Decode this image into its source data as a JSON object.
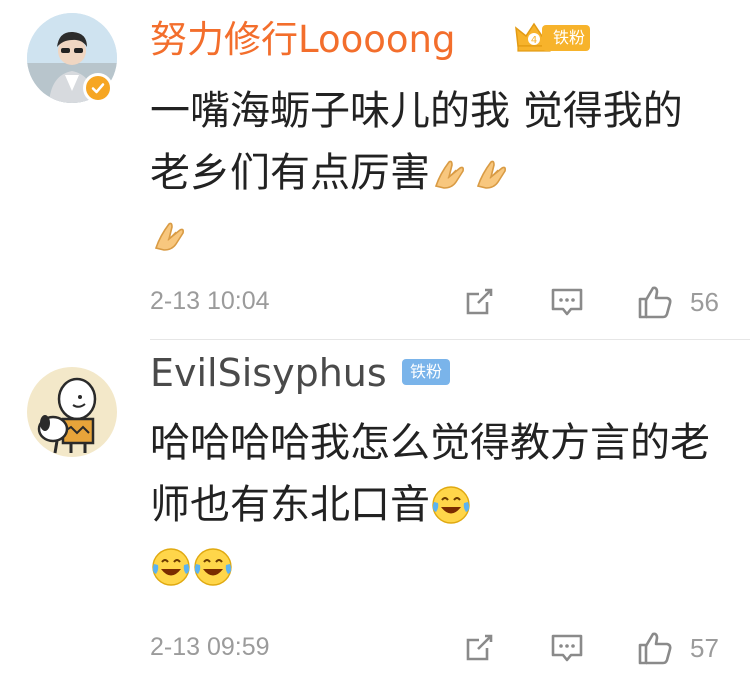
{
  "comments": [
    {
      "username": "努力修行Loooong",
      "badge": "铁粉",
      "badge_level": "4",
      "text": "一嘴海蛎子味儿的我 觉得我的老乡们有点厉害",
      "emojis": [
        "pray",
        "pray",
        "pray"
      ],
      "time": "2-13 10:04",
      "likes": "56",
      "name_color": "#f36e2c",
      "badge_color": "#f7b32b"
    },
    {
      "username": "EvilSisyphus",
      "badge": "铁粉",
      "text": "哈哈哈哈我怎么觉得教方言的老师也有东北口音",
      "emojis": [
        "laugh-cry",
        "laugh-cry",
        "laugh-cry"
      ],
      "time": "2-13 09:59",
      "likes": "57",
      "name_color": "#4a4a4a",
      "badge_color": "#7ab4ea"
    }
  ],
  "icons": {
    "share": "share-icon",
    "reply": "comment-icon",
    "like": "thumbs-up-icon",
    "verified": "verified-icon",
    "crown": "crown-icon"
  }
}
